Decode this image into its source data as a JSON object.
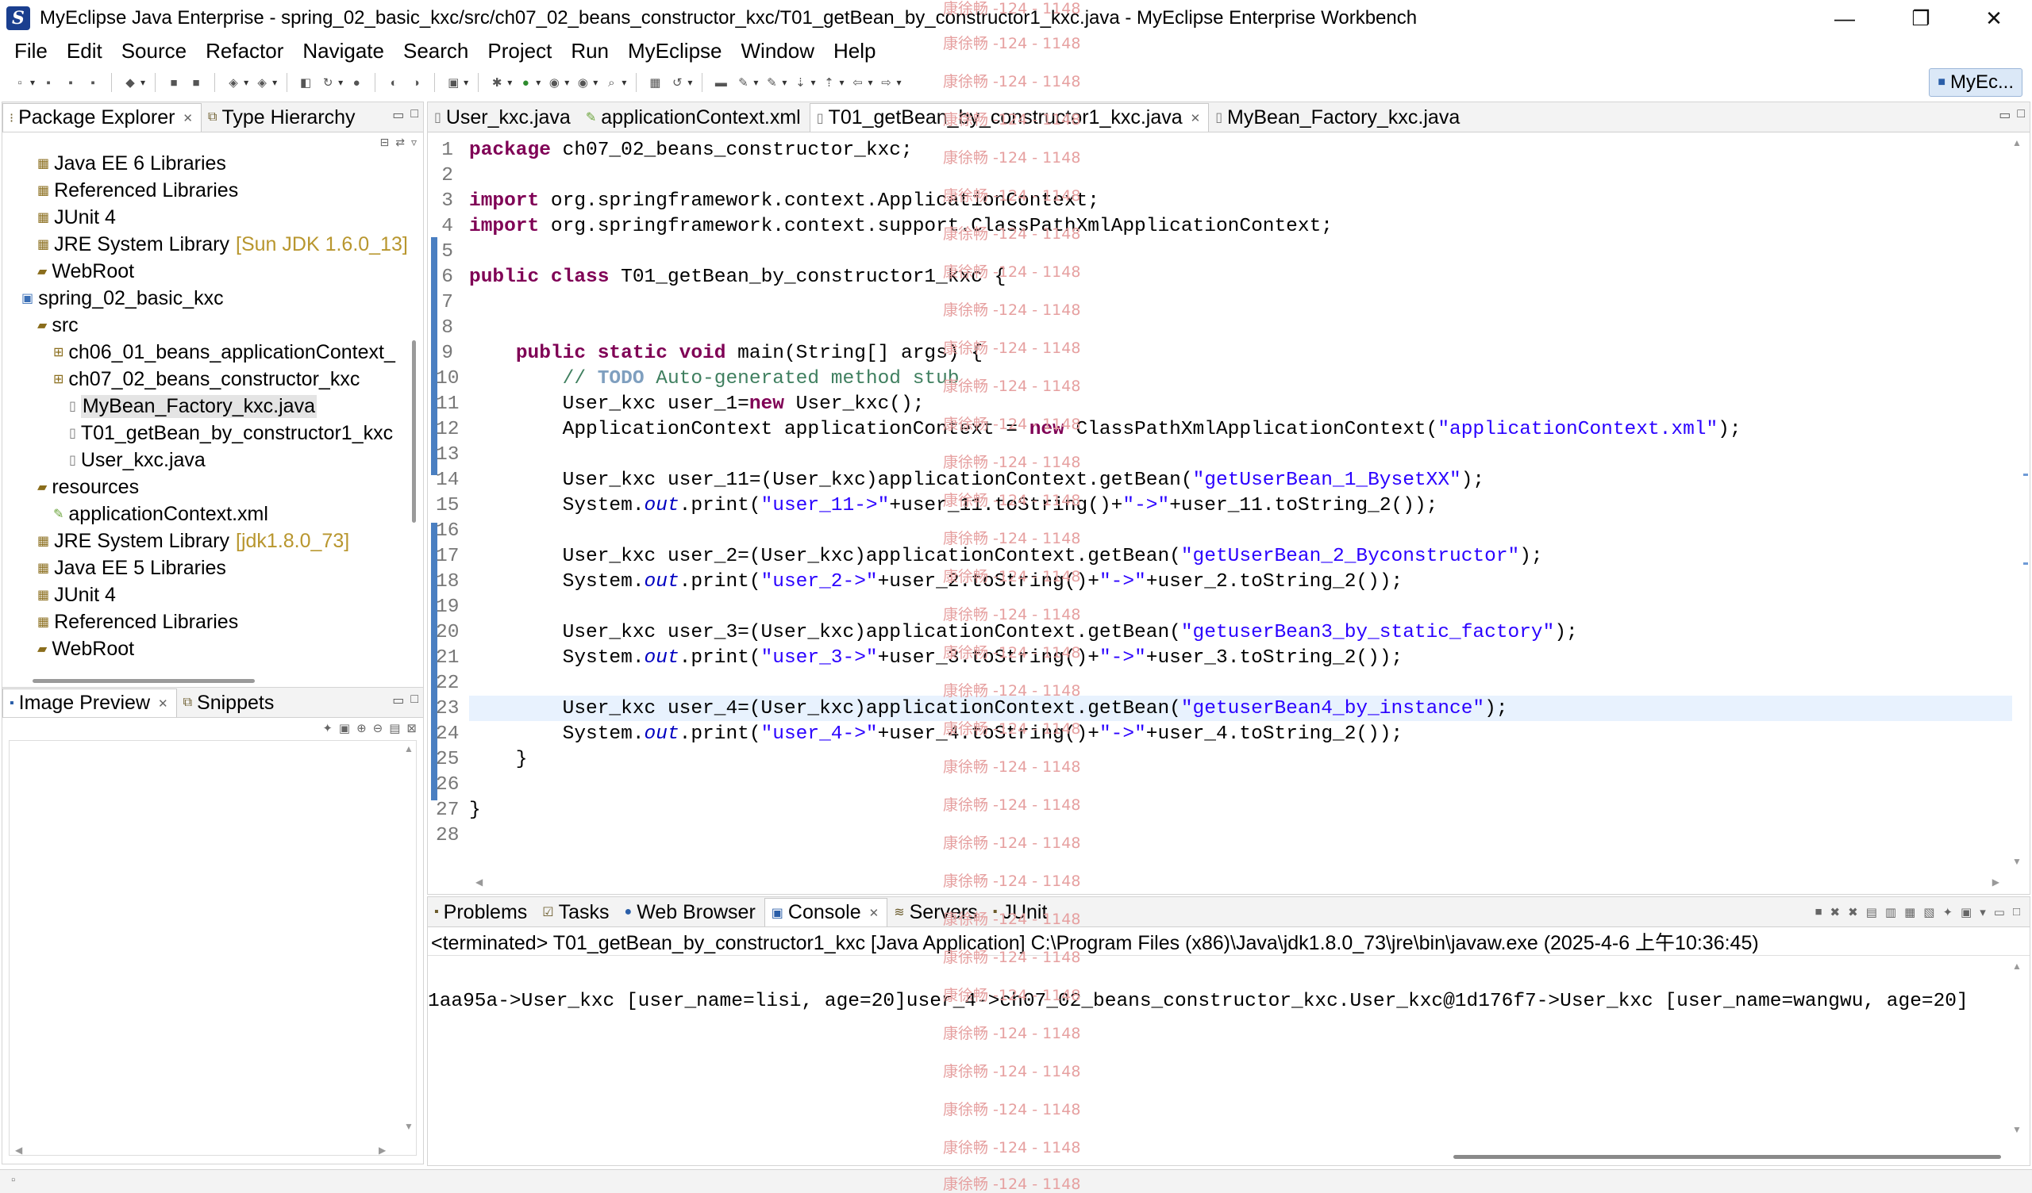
{
  "window": {
    "title": "MyEclipse Java Enterprise - spring_02_basic_kxc/src/ch07_02_beans_constructor_kxc/T01_getBean_by_constructor1_kxc.java - MyEclipse Enterprise Workbench",
    "minimize": "—",
    "maximize": "❐",
    "close": "✕"
  },
  "menu": [
    "File",
    "Edit",
    "Source",
    "Refactor",
    "Navigate",
    "Search",
    "Project",
    "Run",
    "MyEclipse",
    "Window",
    "Help"
  ],
  "perspective": "MyEc...",
  "explorer": {
    "tabs": [
      "Package Explorer",
      "Type Hierarchy"
    ],
    "items": [
      {
        "label": "Java EE 6 Libraries",
        "decoration": ""
      },
      {
        "label": "Referenced Libraries",
        "decoration": ""
      },
      {
        "label": "JUnit 4",
        "decoration": ""
      },
      {
        "label": "JRE System Library",
        "decoration": "[Sun JDK 1.6.0_13]"
      },
      {
        "label": "WebRoot",
        "decoration": ""
      },
      {
        "label": "spring_02_basic_kxc",
        "decoration": ""
      },
      {
        "label": "src",
        "decoration": ""
      },
      {
        "label": "ch06_01_beans_applicationContext_",
        "decoration": ""
      },
      {
        "label": "ch07_02_beans_constructor_kxc",
        "decoration": ""
      },
      {
        "label": "MyBean_Factory_kxc.java",
        "decoration": ""
      },
      {
        "label": "T01_getBean_by_constructor1_kxc",
        "decoration": ""
      },
      {
        "label": "User_kxc.java",
        "decoration": ""
      },
      {
        "label": "resources",
        "decoration": ""
      },
      {
        "label": "applicationContext.xml",
        "decoration": ""
      },
      {
        "label": "JRE System Library",
        "decoration": "[jdk1.8.0_73]"
      },
      {
        "label": "Java EE 5 Libraries",
        "decoration": ""
      },
      {
        "label": "JUnit 4",
        "decoration": ""
      },
      {
        "label": "Referenced Libraries",
        "decoration": ""
      },
      {
        "label": "WebRoot",
        "decoration": ""
      }
    ]
  },
  "preview": {
    "tabs": [
      "Image Preview",
      "Snippets"
    ]
  },
  "editor": {
    "tabs": [
      "User_kxc.java",
      "applicationContext.xml",
      "T01_getBean_by_constructor1_kxc.java",
      "MyBean_Factory_kxc.java"
    ],
    "line_numbers": [
      "1",
      "2",
      "3",
      "4",
      "5",
      "6",
      "7",
      "8",
      "9",
      "10",
      "11",
      "12",
      "13",
      "14",
      "15",
      "16",
      "17",
      "18",
      "19",
      "20",
      "21",
      "22",
      "23",
      "24",
      "25",
      "26",
      "27",
      "28"
    ]
  },
  "bottom": {
    "tabs": [
      "Problems",
      "Tasks",
      "Web Browser",
      "Console",
      "Servers",
      "JUnit"
    ],
    "status": "<terminated> T01_getBean_by_constructor1_kxc [Java Application] C:\\Program Files (x86)\\Java\\jdk1.8.0_73\\jre\\bin\\javaw.exe (2025-4-6 上午10:36:45)",
    "output": "1aa95a->User_kxc [user_name=lisi, age=20]user_4->ch07_02_beans_constructor_kxc.User_kxc@1d176f7->User_kxc [user_name=wangwu, age=20]"
  },
  "watermark": "康徐畅 -124 - 1148"
}
